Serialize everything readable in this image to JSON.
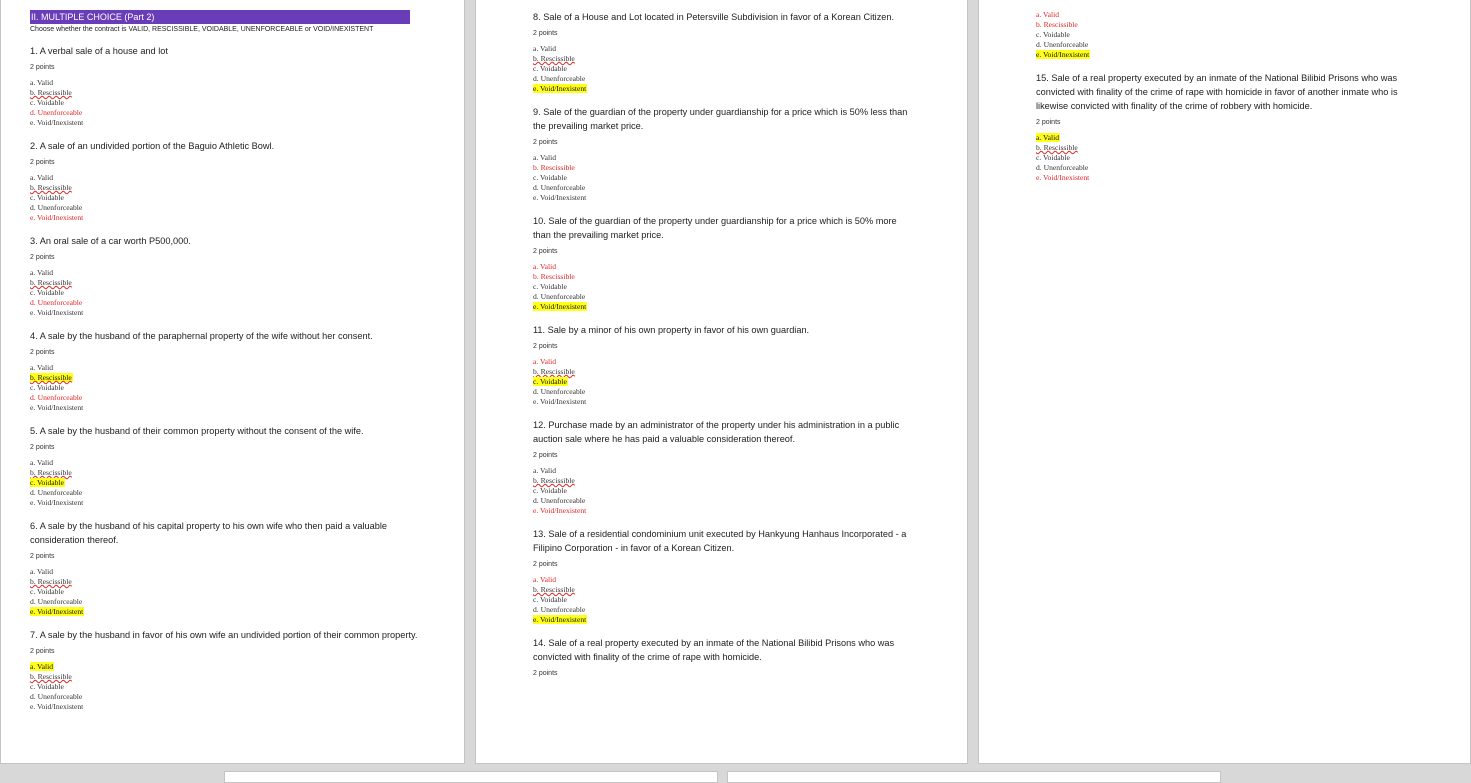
{
  "section": {
    "title": "II. MULTIPLE CHOICE (Part 2)",
    "instructions": "Choose whether the contract is VALID, RESCISSIBLE, VOIDABLE, UNENFORCEABLE or VOID/INEXISTENT"
  },
  "colors": {
    "header_bg": "#6a3db8",
    "marked_red": "#e02525",
    "highlight": "#ffff1a"
  },
  "pages": [
    {
      "questions": [
        {
          "text": "1. A verbal sale of a house and lot",
          "points": "2 points",
          "options": [
            {
              "label": "a. Valid",
              "state": "normal"
            },
            {
              "label": "b. Rescissible",
              "state": "normal"
            },
            {
              "label": "c. Voidable",
              "state": "normal"
            },
            {
              "label": "d. Unenforceable",
              "state": "red"
            },
            {
              "label": "e. Void/Inexistent",
              "state": "normal"
            }
          ]
        },
        {
          "text": "2. A sale of an undivided portion of the Baguio Athletic Bowl.",
          "points": "2 points",
          "options": [
            {
              "label": "a. Valid",
              "state": "normal"
            },
            {
              "label": "b. Rescissible",
              "state": "normal"
            },
            {
              "label": "c. Voidable",
              "state": "normal"
            },
            {
              "label": "d. Unenforceable",
              "state": "normal"
            },
            {
              "label": "e. Void/Inexistent",
              "state": "red"
            }
          ]
        },
        {
          "text": "3. An oral sale of a car worth P500,000.",
          "points": "2 points",
          "options": [
            {
              "label": "a. Valid",
              "state": "normal"
            },
            {
              "label": "b. Rescissible",
              "state": "normal"
            },
            {
              "label": "c. Voidable",
              "state": "normal"
            },
            {
              "label": "d. Unenforceable",
              "state": "red"
            },
            {
              "label": "e. Void/Inexistent",
              "state": "normal"
            }
          ]
        },
        {
          "text": "4. A sale by the husband of the paraphernal property of the wife without her consent.",
          "points": "2 points",
          "options": [
            {
              "label": "a. Valid",
              "state": "normal"
            },
            {
              "label": "b. Rescissible",
              "state": "highlight"
            },
            {
              "label": "c. Voidable",
              "state": "normal"
            },
            {
              "label": "d. Unenforceable",
              "state": "red"
            },
            {
              "label": "e. Void/Inexistent",
              "state": "normal"
            }
          ]
        },
        {
          "text": "5. A sale by the husband of their common property without the consent of the wife.",
          "points": "2 points",
          "options": [
            {
              "label": "a. Valid",
              "state": "normal"
            },
            {
              "label": "b. Rescissible",
              "state": "normal"
            },
            {
              "label": "c. Voidable",
              "state": "highlight"
            },
            {
              "label": "d. Unenforceable",
              "state": "normal"
            },
            {
              "label": "e. Void/Inexistent",
              "state": "normal"
            }
          ]
        },
        {
          "text": "6. A sale by the husband of his capital property to his own wife who then paid a valuable consideration thereof.",
          "points": "2 points",
          "options": [
            {
              "label": "a. Valid",
              "state": "normal"
            },
            {
              "label": "b. Rescissible",
              "state": "normal"
            },
            {
              "label": "c. Voidable",
              "state": "normal"
            },
            {
              "label": "d. Unenforceable",
              "state": "normal"
            },
            {
              "label": "e. Void/Inexistent",
              "state": "highlight"
            }
          ]
        },
        {
          "text": "7. A sale by the husband in favor of his own wife an undivided portion of their common property.",
          "points": "2 points",
          "options": [
            {
              "label": "a. Valid",
              "state": "highlight"
            },
            {
              "label": "b. Rescissible",
              "state": "normal"
            },
            {
              "label": "c. Voidable",
              "state": "normal"
            },
            {
              "label": "d. Unenforceable",
              "state": "normal"
            },
            {
              "label": "e. Void/Inexistent",
              "state": "normal"
            }
          ]
        }
      ]
    },
    {
      "questions": [
        {
          "text": "8. Sale of a House and Lot located in Petersville Subdivision in favor of a Korean Citizen.",
          "points": "2 points",
          "options": [
            {
              "label": "a. Valid",
              "state": "normal"
            },
            {
              "label": "b. Rescissible",
              "state": "normal"
            },
            {
              "label": "c. Voidable",
              "state": "normal"
            },
            {
              "label": "d. Unenforceable",
              "state": "normal"
            },
            {
              "label": "e. Void/Inexistent",
              "state": "highlight"
            }
          ]
        },
        {
          "text": "9. Sale of the guardian of the property under guardianship for a price which is 50% less than the prevailing market price.",
          "points": "2 points",
          "options": [
            {
              "label": "a. Valid",
              "state": "normal"
            },
            {
              "label": "b. Rescissible",
              "state": "red"
            },
            {
              "label": "c. Voidable",
              "state": "normal"
            },
            {
              "label": "d. Unenforceable",
              "state": "normal"
            },
            {
              "label": "e. Void/Inexistent",
              "state": "normal"
            }
          ]
        },
        {
          "text": "10. Sale of the guardian of the property under guardianship for a price which is 50% more than the prevailing market price.",
          "points": "2 points",
          "options": [
            {
              "label": "a. Valid",
              "state": "red"
            },
            {
              "label": "b. Rescissible",
              "state": "red"
            },
            {
              "label": "c. Voidable",
              "state": "normal"
            },
            {
              "label": "d. Unenforceable",
              "state": "normal"
            },
            {
              "label": "e. Void/Inexistent",
              "state": "highlight"
            }
          ]
        },
        {
          "text": "11. Sale by a minor of his own property in favor of his own guardian.",
          "points": "2 points",
          "options": [
            {
              "label": "a. Valid",
              "state": "red"
            },
            {
              "label": "b. Rescissible",
              "state": "normal"
            },
            {
              "label": "c. Voidable",
              "state": "highlight"
            },
            {
              "label": "d. Unenforceable",
              "state": "normal"
            },
            {
              "label": "e. Void/Inexistent",
              "state": "normal"
            }
          ]
        },
        {
          "text": "12. Purchase made by an administrator of the property under his administration in a public auction sale where he has paid a valuable consideration thereof.",
          "points": "2 points",
          "options": [
            {
              "label": "a. Valid",
              "state": "normal"
            },
            {
              "label": "b. Rescissible",
              "state": "normal"
            },
            {
              "label": "c. Voidable",
              "state": "normal"
            },
            {
              "label": "d. Unenforceable",
              "state": "normal"
            },
            {
              "label": "e. Void/Inexistent",
              "state": "red"
            }
          ]
        },
        {
          "text": "13. Sale of a residential condominium unit executed by Hankyung Hanhaus Incorporated - a Filipino Corporation - in favor of a Korean Citizen.",
          "points": "2 points",
          "options": [
            {
              "label": "a. Valid",
              "state": "red"
            },
            {
              "label": "b. Rescissible",
              "state": "normal"
            },
            {
              "label": "c. Voidable",
              "state": "normal"
            },
            {
              "label": "d. Unenforceable",
              "state": "normal"
            },
            {
              "label": "e. Void/Inexistent",
              "state": "highlight"
            }
          ]
        },
        {
          "text": "14. Sale of a real property executed by an inmate of the National Bilibid Prisons who was convicted with finality of the crime of rape with homicide.",
          "points": "2 points",
          "options": []
        }
      ]
    },
    {
      "carryover_options": [
        {
          "label": "a. Valid",
          "state": "red"
        },
        {
          "label": "b. Rescissible",
          "state": "red"
        },
        {
          "label": "c. Voidable",
          "state": "normal"
        },
        {
          "label": "d. Unenforceable",
          "state": "normal"
        },
        {
          "label": "e. Void/Inexistent",
          "state": "highlight"
        }
      ],
      "questions": [
        {
          "text": "15. Sale of a real property executed by an inmate of the National Bilibid Prisons who was convicted with finality of the crime of rape with homicide in favor of another inmate who is likewise convicted with finality of the crime of robbery with homicide.",
          "points": "2 points",
          "options": [
            {
              "label": "a. Valid",
              "state": "highlight"
            },
            {
              "label": "b. Rescissible",
              "state": "normal"
            },
            {
              "label": "c. Voidable",
              "state": "normal"
            },
            {
              "label": "d. Unenforceable",
              "state": "normal"
            },
            {
              "label": "e. Void/Inexistent",
              "state": "red"
            }
          ]
        }
      ]
    }
  ]
}
